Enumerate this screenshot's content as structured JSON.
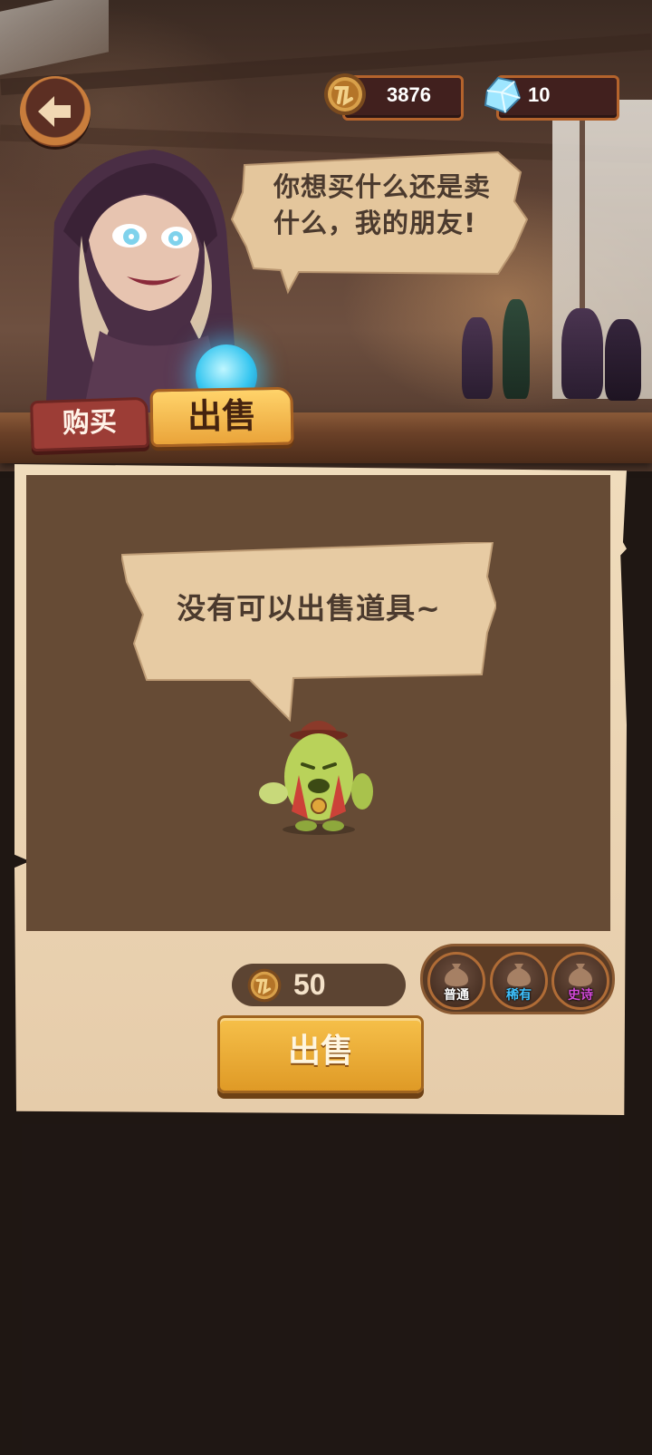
{
  "header": {
    "coins": "3876",
    "gems": "10"
  },
  "shopkeeper": {
    "speech": "你想买什么还是卖什么，我的朋友!"
  },
  "tabs": [
    {
      "label": "购买",
      "active": false
    },
    {
      "label": "出售",
      "active": true
    }
  ],
  "panel": {
    "empty_message": "没有可以出售道具~",
    "price": "50",
    "sell_label": "出售"
  },
  "rarity_filters": [
    {
      "label": "普通",
      "color": "#ffffff"
    },
    {
      "label": "稀有",
      "color": "#3fc2ff"
    },
    {
      "label": "史诗",
      "color": "#d44ad8"
    }
  ],
  "colors": {
    "accent_gold": "#f6c04a",
    "panel_dark": "#664b35",
    "parchment": "#f0dcbc"
  }
}
